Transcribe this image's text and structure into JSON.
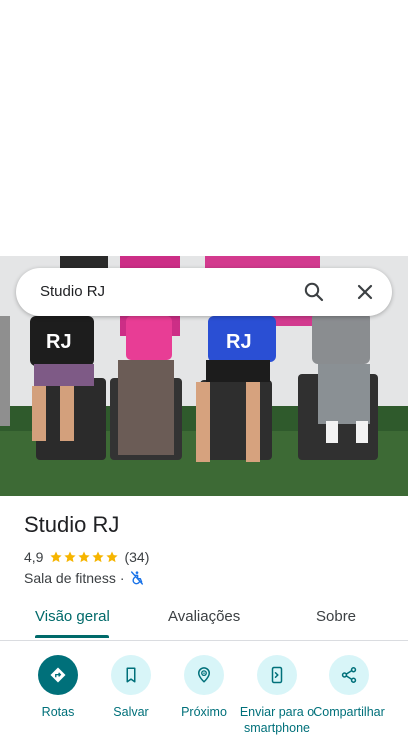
{
  "search": {
    "query": "Studio RJ"
  },
  "place": {
    "name": "Studio RJ",
    "rating": "4,9",
    "stars": 5,
    "reviews_count": "(34)",
    "category": "Sala de fitness",
    "separator": "·"
  },
  "tabs": [
    {
      "label": "Visão geral",
      "active": true
    },
    {
      "label": "Avaliações",
      "active": false
    },
    {
      "label": "Sobre",
      "active": false
    }
  ],
  "actions": [
    {
      "label": "Rotas",
      "icon": "directions-icon"
    },
    {
      "label": "Salvar",
      "icon": "bookmark-icon"
    },
    {
      "label": "Próximo",
      "icon": "nearby-icon"
    },
    {
      "label": "Enviar para o smartphone",
      "icon": "send-to-phone-icon"
    },
    {
      "label": "Compartilhar",
      "icon": "share-icon"
    }
  ],
  "photo": {
    "shirt_lettering": "RJ"
  },
  "colors": {
    "accent": "#00707a",
    "star": "#f6b500",
    "chip_bg": "#d8f5f8"
  }
}
